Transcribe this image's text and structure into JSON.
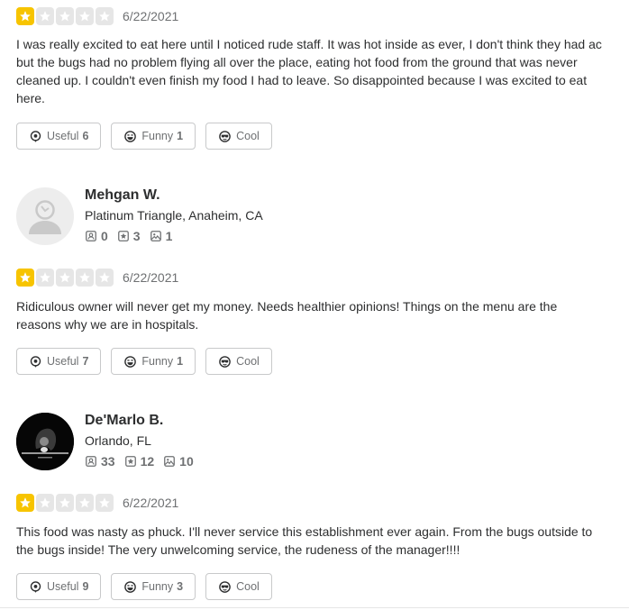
{
  "reviews": [
    {
      "rating": 1,
      "date": "6/22/2021",
      "text": "I was really excited to eat here until I noticed rude staff. It was hot inside as ever, I don't think they had ac but the bugs had no problem flying all over the place, eating hot food from the ground that was never cleaned up. I couldn't even finish my food I had to leave. So disappointed because I was excited to eat here.",
      "useful_label": "Useful",
      "useful_count": "6",
      "funny_label": "Funny",
      "funny_count": "1",
      "cool_label": "Cool"
    },
    {
      "user": {
        "name": "Mehgan W.",
        "location": "Platinum Triangle, Anaheim, CA",
        "friends": "0",
        "reviews": "3",
        "photos": "1",
        "avatar": "default-avatar-icon"
      },
      "rating": 1,
      "date": "6/22/2021",
      "text": "Ridiculous owner will never get my money. Needs healthier opinions! Things on the menu are the reasons why we are in hospitals.",
      "useful_label": "Useful",
      "useful_count": "7",
      "funny_label": "Funny",
      "funny_count": "1",
      "cool_label": "Cool"
    },
    {
      "user": {
        "name": "De'Marlo B.",
        "location": "Orlando, FL",
        "friends": "33",
        "reviews": "12",
        "photos": "10",
        "avatar": "user-photo"
      },
      "rating": 1,
      "date": "6/22/2021",
      "text": "This food was nasty as phuck. I'll never service this establishment ever again. From the bugs outside to the bugs inside! The very unwelcoming service, the rudeness of the manager!!!!",
      "useful_label": "Useful",
      "useful_count": "9",
      "funny_label": "Funny",
      "funny_count": "3",
      "cool_label": "Cool"
    }
  ],
  "colors": {
    "star_filled": "#f7c400",
    "star_empty": "#e6e6e6",
    "text": "#2d2e2f",
    "muted": "#6e7072",
    "border": "#c8c9ca"
  }
}
